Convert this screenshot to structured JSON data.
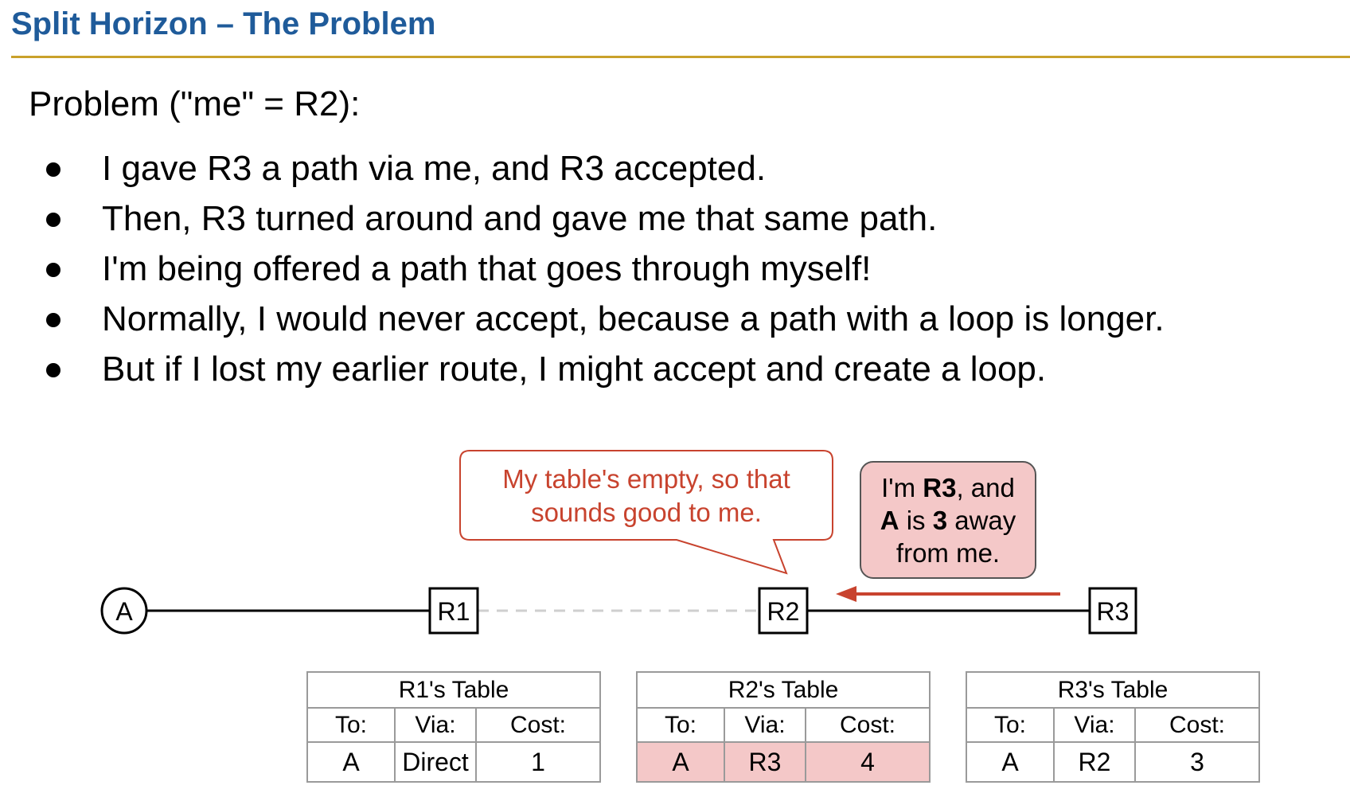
{
  "title": "Split Horizon – The Problem",
  "heading": "Problem (\"me\" = R2):",
  "bullets": [
    "I gave R3 a path via me, and R3 accepted.",
    "Then, R3 turned around and gave me that same path.",
    "I'm being offered a path that goes through myself!",
    "Normally, I would never accept, because a path with a loop is longer.",
    "But if I lost my earlier route, I might accept and create a loop."
  ],
  "diagram": {
    "nodes": {
      "dest": "A",
      "r1": "R1",
      "r2": "R2",
      "r3": "R3"
    },
    "r2_callout": [
      "My table's empty, so that",
      "sounds good to me."
    ],
    "r3_callout": {
      "line1": [
        "I'm ",
        "R3",
        ", and"
      ],
      "line2": [
        "A",
        " is ",
        "3",
        " away"
      ],
      "line3": "from me."
    },
    "colors": {
      "r2_callout": "#c8432e",
      "r3_callout_fill": "#f4c8c8",
      "arrow": "#c8432e",
      "highlight": "#f4c8c8"
    }
  },
  "tables": [
    {
      "caption": "R1's Table",
      "headers": [
        "To:",
        "Via:",
        "Cost:"
      ],
      "row": [
        "A",
        "Direct",
        "1"
      ],
      "highlighted": false
    },
    {
      "caption": "R2's Table",
      "headers": [
        "To:",
        "Via:",
        "Cost:"
      ],
      "row": [
        "A",
        "R3",
        "4"
      ],
      "highlighted": true
    },
    {
      "caption": "R3's Table",
      "headers": [
        "To:",
        "Via:",
        "Cost:"
      ],
      "row": [
        "A",
        "R2",
        "3"
      ],
      "highlighted": false
    }
  ]
}
